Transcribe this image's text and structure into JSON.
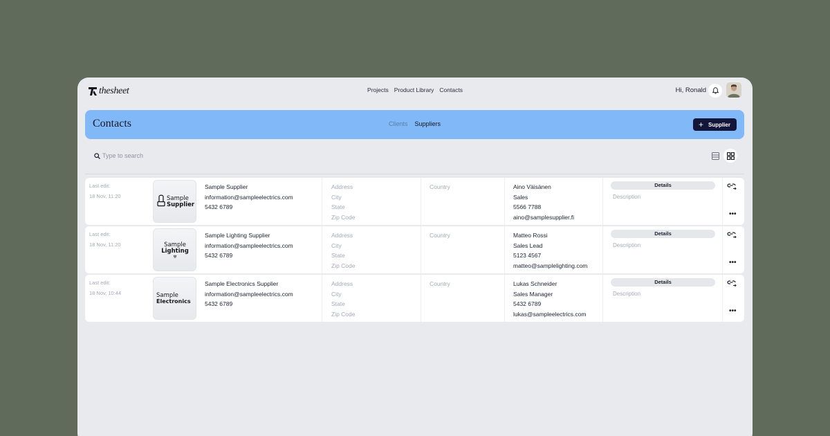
{
  "app": {
    "logo_text": "thesheet"
  },
  "nav": {
    "items": [
      "Projects",
      "Product Library",
      "Contacts"
    ]
  },
  "user": {
    "greeting": "Hi, Ronald"
  },
  "page": {
    "title": "Contacts",
    "tabs": [
      "Clients",
      "Suppliers"
    ],
    "active_tab": "Suppliers",
    "add_button": "Supplier"
  },
  "search": {
    "placeholder": "Type to search"
  },
  "colors": {
    "banner": "#80b8f8",
    "button": "#13163a",
    "background": "#606b5c"
  },
  "rows": [
    {
      "edit_label": "Last edit:",
      "edit_time": "18 Nov, 11:20",
      "logo_top": "Sample",
      "logo_bottom": "Supplier",
      "name": "Sample Supplier",
      "email": "information@sampleelectrics.com",
      "phone": "5432 6789",
      "address": "Address",
      "city": "City",
      "state": "State",
      "zip": "Zip Code",
      "country": "Country",
      "contact_name": "Aino Väisänen",
      "contact_role": "Sales",
      "contact_phone": "5566 7788",
      "contact_email": "aino@samplesupplier.fi",
      "details": "Details",
      "description": "Description"
    },
    {
      "edit_label": "Last edit:",
      "edit_time": "18 Nov, 11:20",
      "logo_top": "Sample",
      "logo_bottom": "Lighting",
      "name": "Sample Lighting Supplier",
      "email": "information@sampleelectrics.com",
      "phone": "5432 6789",
      "address": "Address",
      "city": "City",
      "state": "State",
      "zip": "Zip Code",
      "country": "Country",
      "contact_name": "Matteo Rossi",
      "contact_role": "Sales Lead",
      "contact_phone": "5123 4567",
      "contact_email": "matteo@samplelighting.com",
      "details": "Details",
      "description": "Description"
    },
    {
      "edit_label": "Last edit:",
      "edit_time": "18 Nov, 10:44",
      "logo_top": "Sample",
      "logo_bottom": "Electronics",
      "name": "Sample Electronics Supplier",
      "email": "information@sampleelectrics.com",
      "phone": "5432 6789",
      "address": "Address",
      "city": "City",
      "state": "State",
      "zip": "Zip Code",
      "country": "Country",
      "contact_name": "Lukas Schneider",
      "contact_role": "Sales Manager",
      "contact_phone": "5432 6789",
      "contact_email": "lukas@sampleelectrics.com",
      "details": "Details",
      "description": "Description"
    }
  ]
}
